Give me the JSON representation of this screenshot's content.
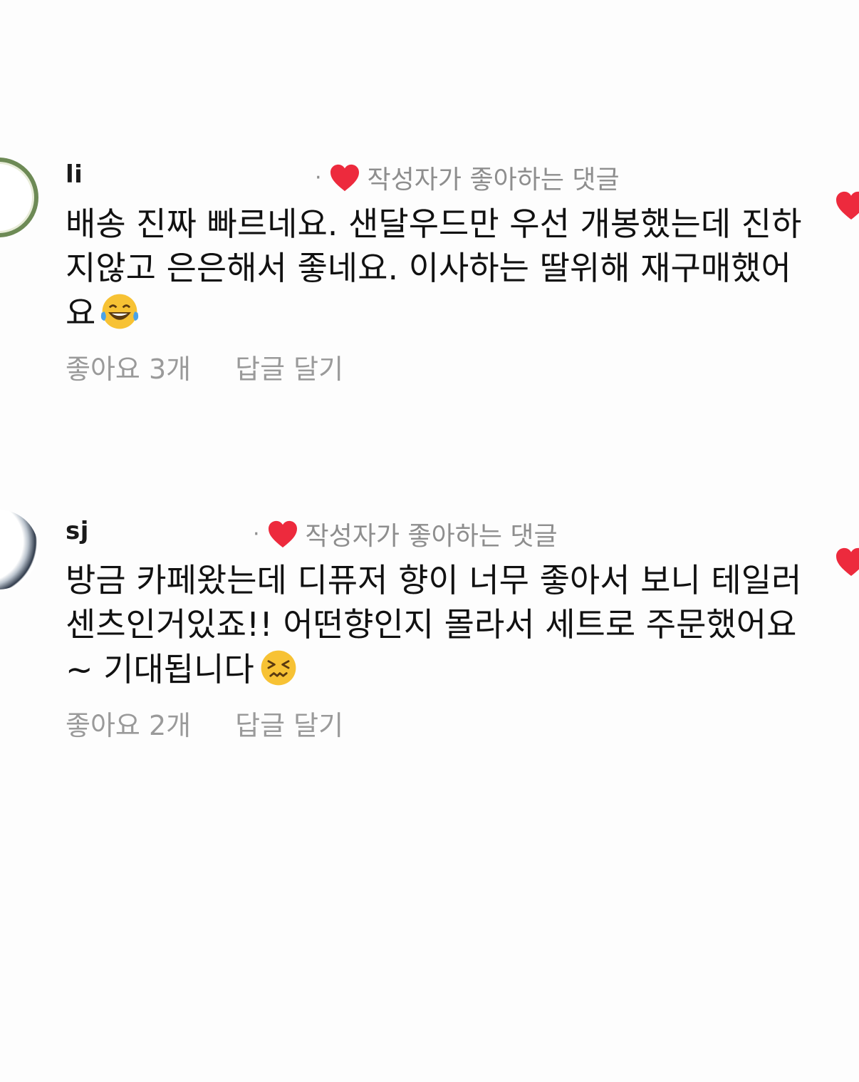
{
  "comments": [
    {
      "username": "li",
      "author_liked_label": "작성자가 좋아하는 댓글",
      "separator": "·",
      "text": "배송 진짜 빠르네요. 샌달우드만 우선 개봉했는데 진하지않고 은은해서 좋네요. 이사하는 딸위해 재구매했어요",
      "emoji": "tears-of-joy-emoji",
      "likes_label": "좋아요 3개",
      "reply_label": "답글 달기"
    },
    {
      "username": "sj",
      "author_liked_label": "작성자가 좋아하는 댓글",
      "separator": "·",
      "text": "방금 카페왔는데 디퓨저 향이 너무 좋아서 보니 테일러센츠인거있죠!! 어떤향인지 몰라서 세트로 주문했어요~ 기대됩니다",
      "emoji": "confounded-face-emoji",
      "likes_label": "좋아요 2개",
      "reply_label": "답글 달기"
    }
  ],
  "colors": {
    "heart": "#ed2a3d",
    "secondary_text": "#8e8e8e",
    "primary_text": "#111111",
    "background": "#fdfdfd"
  }
}
